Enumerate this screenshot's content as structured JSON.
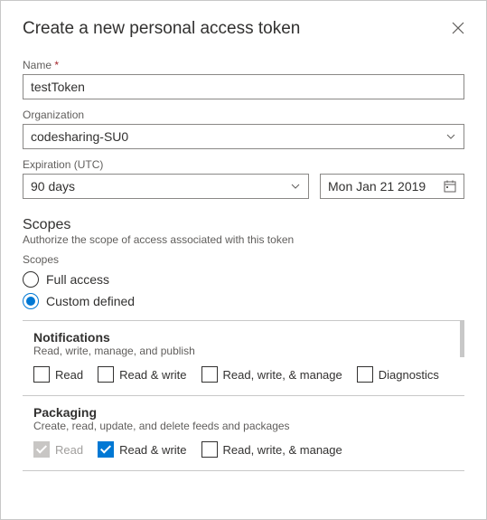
{
  "title": "Create a new personal access token",
  "fields": {
    "nameLabel": "Name",
    "nameValue": "testToken",
    "orgLabel": "Organization",
    "orgValue": "codesharing-SU0",
    "expLabel": "Expiration (UTC)",
    "expValue": "90 days",
    "dateValue": "Mon Jan 21 2019"
  },
  "scopes": {
    "header": "Scopes",
    "sub": "Authorize the scope of access associated with this token",
    "groupLabel": "Scopes",
    "radioFull": "Full access",
    "radioCustom": "Custom defined",
    "sections": [
      {
        "title": "Notifications",
        "desc": "Read, write, manage, and publish",
        "options": [
          {
            "label": "Read",
            "checked": false,
            "disabled": false
          },
          {
            "label": "Read & write",
            "checked": false,
            "disabled": false
          },
          {
            "label": "Read, write, & manage",
            "checked": false,
            "disabled": false
          },
          {
            "label": "Diagnostics",
            "checked": false,
            "disabled": false
          }
        ]
      },
      {
        "title": "Packaging",
        "desc": "Create, read, update, and delete feeds and packages",
        "options": [
          {
            "label": "Read",
            "checked": true,
            "disabled": true
          },
          {
            "label": "Read & write",
            "checked": true,
            "disabled": false
          },
          {
            "label": "Read, write, & manage",
            "checked": false,
            "disabled": false
          }
        ]
      }
    ]
  }
}
